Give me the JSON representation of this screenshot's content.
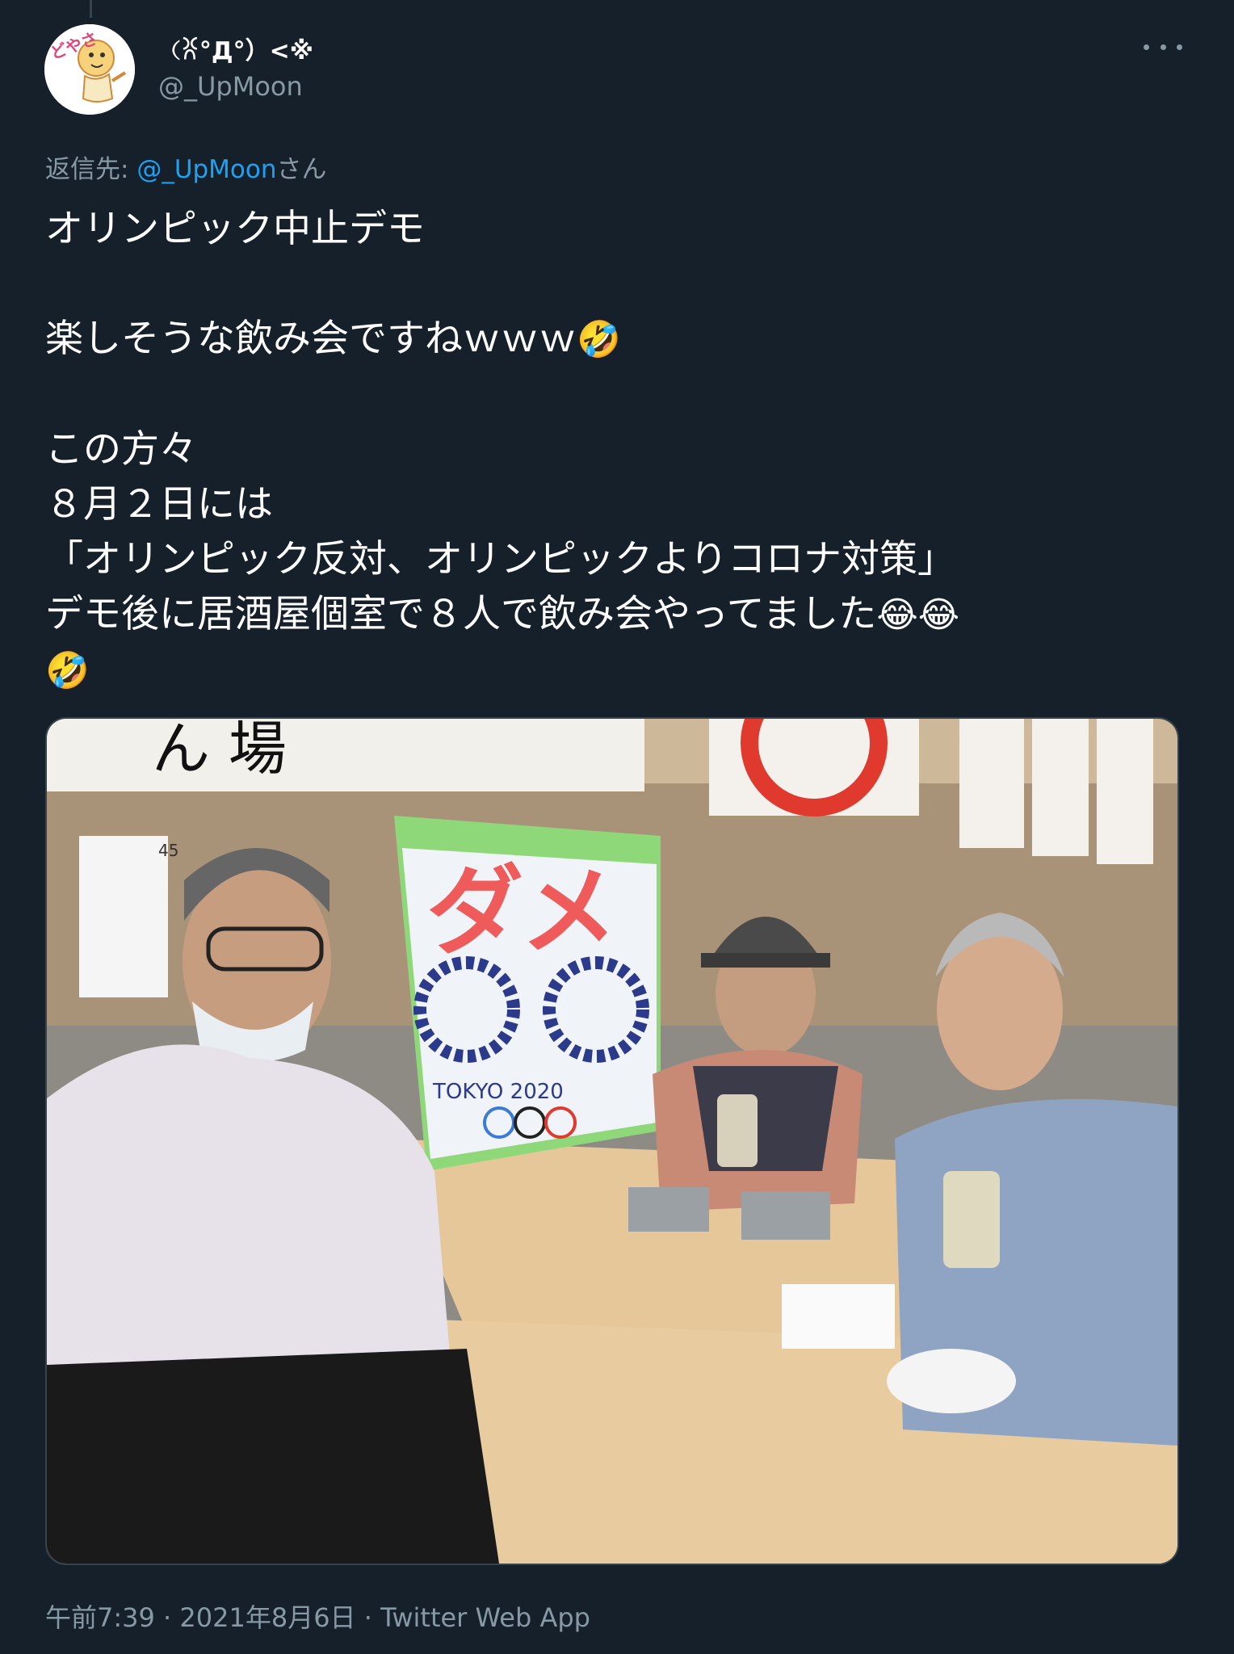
{
  "user": {
    "display_name": "（ꐦ°Д°）<※",
    "handle": "@_UpMoon",
    "avatar_text": "どやさ"
  },
  "reply": {
    "prefix": "返信先: ",
    "mention": "@_UpMoon",
    "suffix": "さん"
  },
  "tweet": {
    "line1": "オリンピック中止デモ",
    "line2": "楽しそうな飲み会ですねｗｗｗ",
    "line3": "この方々",
    "line4": "８月２日には",
    "line5": "「オリンピック反対、オリンピックよりコロナ対策」",
    "line6": "デモ後に居酒屋個室で８人で飲み会やってました",
    "emoji_rofl": "🤣",
    "emoji_joy": "😂"
  },
  "photo": {
    "sign_text": "ダメ",
    "sign_tokyo": "TOKYO 2020",
    "table_number": "45",
    "banner_text": "ん 場"
  },
  "meta": {
    "time": "午前7:39",
    "sep1": " · ",
    "date": "2021年8月6日",
    "sep2": " · ",
    "app": "Twitter Web App"
  },
  "colors": {
    "background": "#15202b",
    "text_primary": "#ffffff",
    "text_secondary": "#8899a6",
    "link": "#1da1f2"
  }
}
